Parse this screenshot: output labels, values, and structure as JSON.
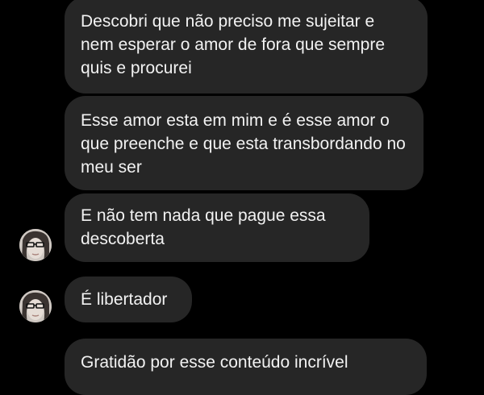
{
  "chat": {
    "messages": [
      {
        "text": "Descobri que não preciso me sujeitar e nem esperar o amor de fora que sempre quis e procurei"
      },
      {
        "text": "Esse amor esta em mim e é esse amor o que preenche e que esta transbordando no meu ser"
      },
      {
        "text": "E não tem nada que pague essa descoberta"
      },
      {
        "text": "É libertador"
      },
      {
        "text": "Gratidão por esse conteúdo incrível"
      }
    ]
  },
  "colors": {
    "background": "#000000",
    "bubble": "#262626",
    "text": "#f2f2f2"
  },
  "icons": {
    "avatar": "sender-avatar"
  }
}
